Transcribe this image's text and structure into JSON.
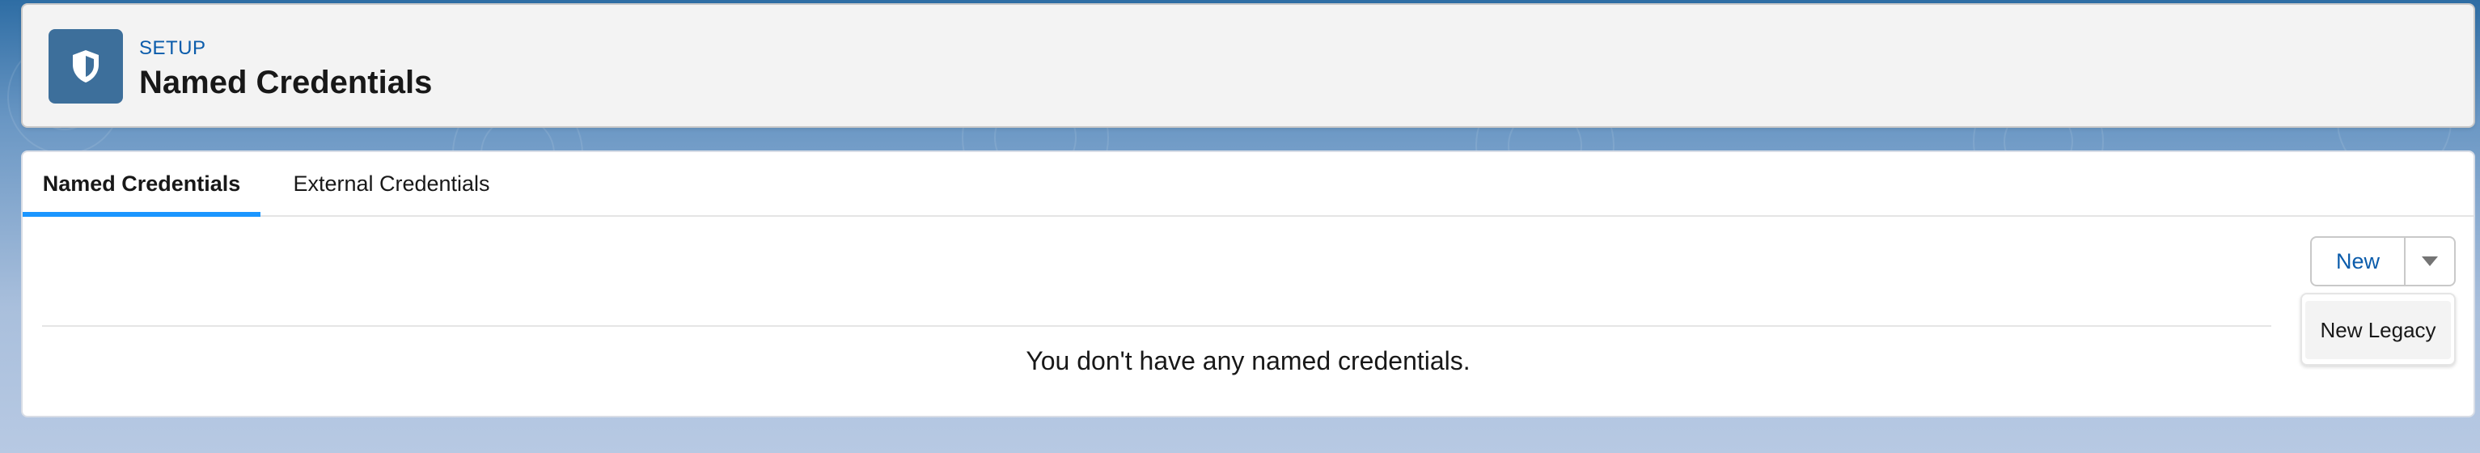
{
  "header": {
    "section_label": "SETUP",
    "title": "Named Credentials",
    "icon": "shield-icon"
  },
  "tabs": [
    {
      "label": "Named Credentials",
      "active": true
    },
    {
      "label": "External Credentials",
      "active": false
    }
  ],
  "actions": {
    "new_label": "New",
    "menu_icon": "chevron-down-icon"
  },
  "dropdown": {
    "items": [
      {
        "label": "New Legacy"
      }
    ]
  },
  "empty_state": {
    "message": "You don't have any named credentials."
  },
  "colors": {
    "accent": "#1b96ff",
    "link": "#0b5cab",
    "icon_bg": "#3d6f9b",
    "header_bg": "#f3f3f3"
  }
}
